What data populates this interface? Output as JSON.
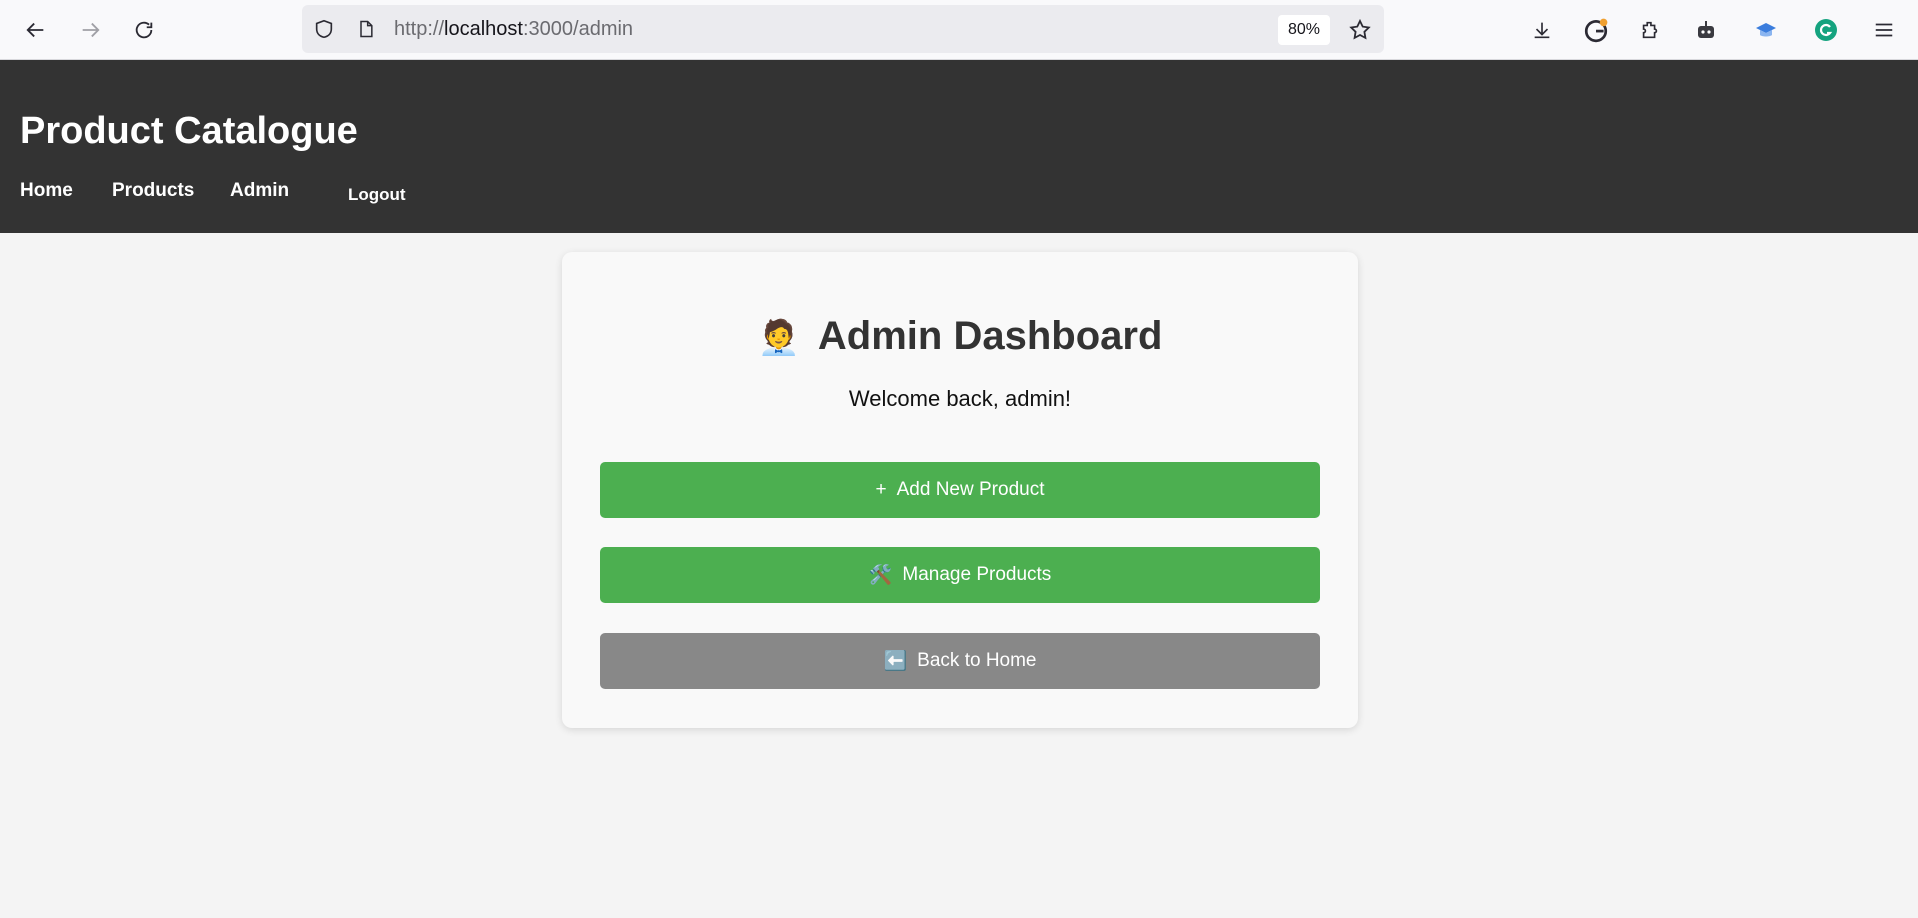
{
  "browser": {
    "url_scheme": "http://",
    "url_host": "localhost",
    "url_rest": ":3000/admin",
    "zoom": "80%"
  },
  "site": {
    "title": "Product Catalogue",
    "nav": {
      "home": "Home",
      "products": "Products",
      "admin": "Admin",
      "logout": "Logout"
    }
  },
  "dashboard": {
    "title_emoji": "🧑‍💼",
    "title": "Admin Dashboard",
    "welcome": "Welcome back, admin!",
    "buttons": {
      "add_icon": "+",
      "add_label": "Add New Product",
      "manage_icon": "🛠️",
      "manage_label": "Manage Products",
      "back_icon": "⬅️",
      "back_label": "Back to Home"
    }
  },
  "colors": {
    "header_bg": "#333333",
    "primary_green": "#4caf50",
    "secondary_grey": "#888888",
    "page_bg": "#f4f4f4"
  }
}
